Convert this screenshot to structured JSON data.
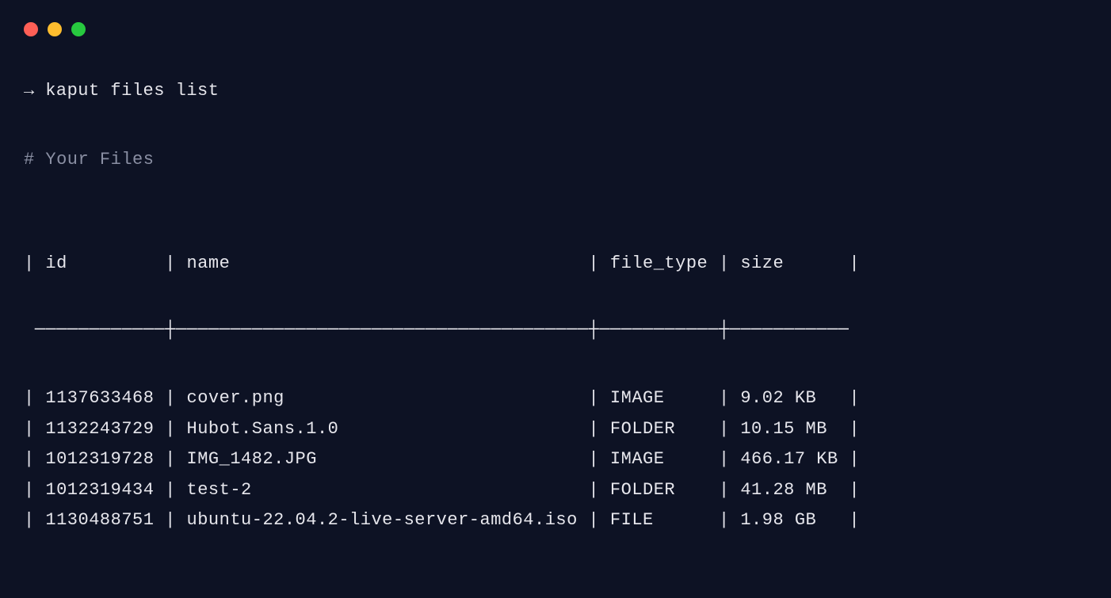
{
  "prompt_arrow": "→",
  "command": "kaput files list",
  "section_title": "# Your Files",
  "table": {
    "columns": [
      "id",
      "name",
      "file_type",
      "size"
    ],
    "rows": [
      {
        "id": "1137633468",
        "name": "cover.png",
        "file_type": "IMAGE",
        "size": "9.02 KB"
      },
      {
        "id": "1132243729",
        "name": "Hubot.Sans.1.0",
        "file_type": "FOLDER",
        "size": "10.15 MB"
      },
      {
        "id": "1012319728",
        "name": "IMG_1482.JPG",
        "file_type": "IMAGE",
        "size": "466.17 KB"
      },
      {
        "id": "1012319434",
        "name": "test-2",
        "file_type": "FOLDER",
        "size": "41.28 MB"
      },
      {
        "id": "1130488751",
        "name": "ubuntu-22.04.2-live-server-amd64.iso",
        "file_type": "FILE",
        "size": "1.98 GB"
      }
    ]
  },
  "widths": {
    "id": 10,
    "name": 36,
    "file_type": 9,
    "size": 9
  }
}
